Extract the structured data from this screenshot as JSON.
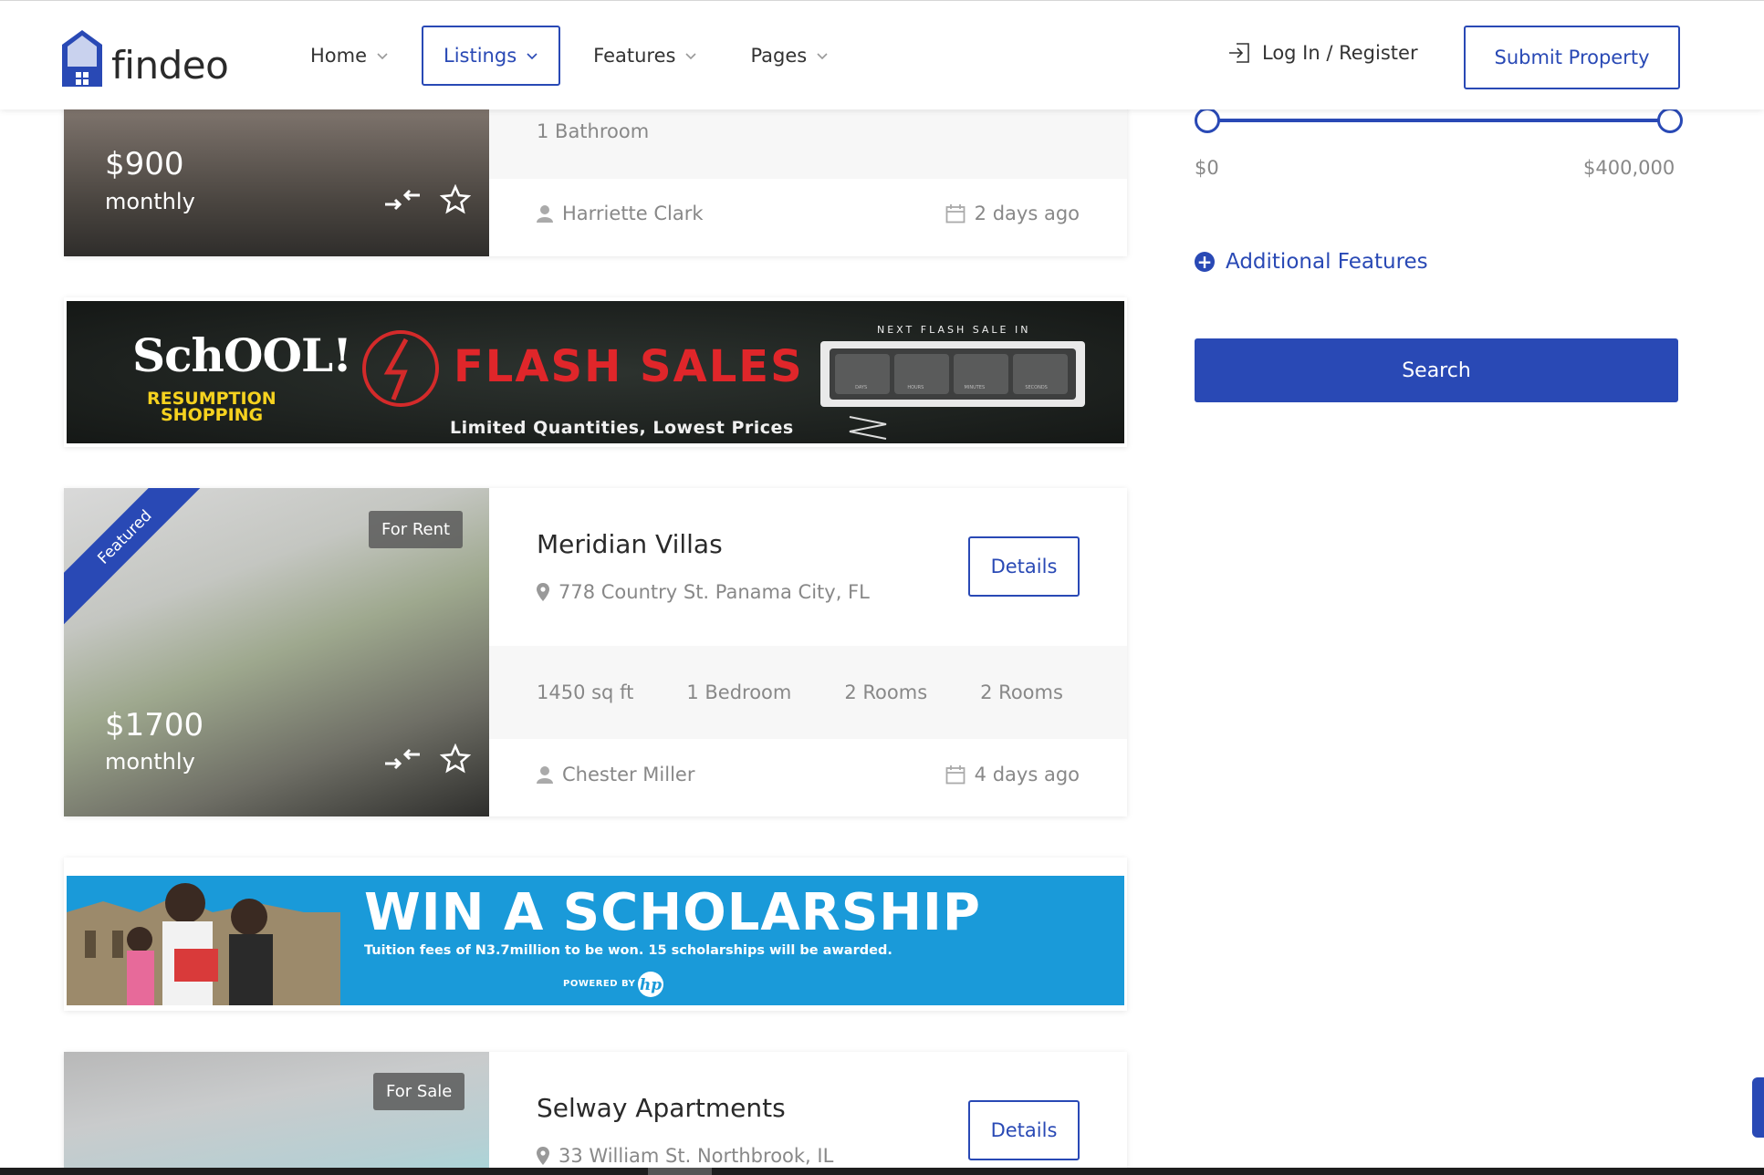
{
  "header": {
    "logo_text": "findeo",
    "nav": [
      {
        "label": "Home"
      },
      {
        "label": "Listings"
      },
      {
        "label": "Features"
      },
      {
        "label": "Pages"
      }
    ],
    "login_label": "Log In / Register",
    "submit_label": "Submit Property"
  },
  "listings": [
    {
      "price": "$900",
      "price_period": "monthly",
      "specs": [
        "1 Bathroom"
      ],
      "agent": "Harriette Clark",
      "date": "2 days ago"
    },
    {
      "badge": "Featured",
      "tag": "For Rent",
      "title": "Meridian Villas",
      "address": "778 Country St. Panama City, FL",
      "details_label": "Details",
      "price": "$1700",
      "price_period": "monthly",
      "specs": [
        "1450 sq ft",
        "1 Bedroom",
        "2 Rooms",
        "2 Rooms"
      ],
      "agent": "Chester Miller",
      "date": "4 days ago"
    },
    {
      "tag": "For Sale",
      "title": "Selway Apartments",
      "address": "33 William St. Northbrook, IL",
      "details_label": "Details"
    }
  ],
  "ads": {
    "flash": {
      "school_line1": "SchOOL!",
      "school_line2": "RESUMPTION",
      "school_line3": "SHOPPING",
      "headline": "FLASH SALES",
      "subline": "Limited Quantities, Lowest Prices",
      "countdown_title": "NEXT FLASH SALE IN",
      "countdown_labels": [
        "DAYS",
        "HOURS",
        "MINUTES",
        "SECONDS"
      ]
    },
    "scholarship": {
      "headline": "WIN A SCHOLARSHIP",
      "subline": "Tuition fees of N3.7million to be won. 15 scholarships will be awarded.",
      "powered_by": "POWERED BY",
      "brand": "hp"
    }
  },
  "sidebar": {
    "price_min": "$0",
    "price_max": "$400,000",
    "additional_features_label": "Additional Features",
    "search_label": "Search",
    "slider_min_fraction": 0,
    "slider_max_fraction": 1
  },
  "colors": {
    "accent": "#2949b5",
    "muted_text": "#888888",
    "flash_red": "#e0262a",
    "school_yellow": "#f6d21f",
    "scholarship_blue": "#1a9ad9"
  }
}
